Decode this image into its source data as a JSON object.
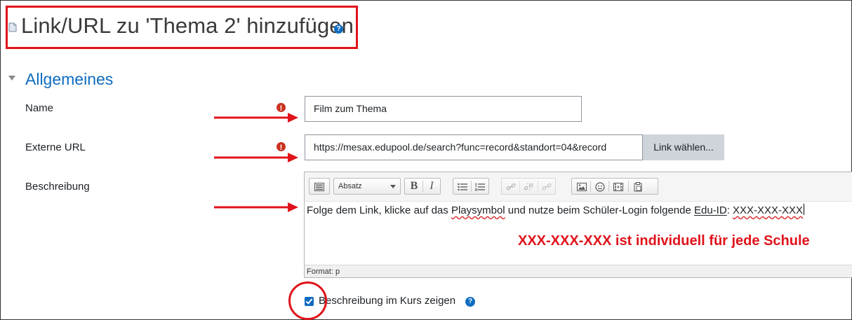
{
  "page": {
    "title": "Link/URL zu 'Thema 2' hinzufügen",
    "help_glyph": "?"
  },
  "section": {
    "title": "Allgemeines"
  },
  "form": {
    "name": {
      "label": "Name",
      "value": "Film zum Thema",
      "required": true
    },
    "url": {
      "label": "Externe URL",
      "value": "https://mesax.edupool.de/search?func=record&standort=04&record",
      "button": "Link wählen...",
      "required": true
    },
    "description": {
      "label": "Beschreibung",
      "toolbar": {
        "block_format": "Absatz",
        "bold": "B",
        "italic": "I"
      },
      "content_parts": {
        "p1": "Folge dem Link, klicke auf das ",
        "p2": "Playsymbol",
        "p3": " und nutze beim Schüler-Login folgende ",
        "p4": "Edu-ID",
        "p5": ": ",
        "p6": "XXX-XXX-XXX"
      },
      "status": "Format: p"
    },
    "show_description": {
      "label": "Beschreibung im Kurs zeigen",
      "checked": true,
      "help_glyph": "?"
    }
  },
  "annotation": {
    "text": "XXX-XXX-XXX ist individuell für jede Schule"
  },
  "colors": {
    "highlight": "#e0131a",
    "accent": "#0f6cbf",
    "required": "#ca3120"
  },
  "icons": [
    "page-icon",
    "help-icon",
    "chevron-down-icon",
    "required-icon",
    "image-icon",
    "emoji-icon",
    "media-icon",
    "paste-icon",
    "link-icon",
    "unlink-icon"
  ]
}
